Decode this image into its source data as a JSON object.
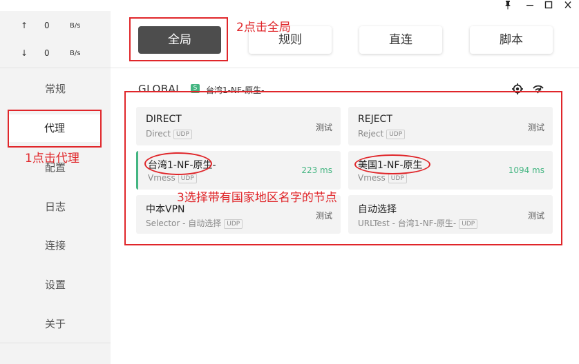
{
  "titlebar": {
    "pin_icon": "pin-icon",
    "min_icon": "minimize-icon",
    "max_icon": "maximize-icon",
    "close_icon": "close-icon"
  },
  "speed": {
    "up": {
      "arrow": "↑",
      "value": "0",
      "unit": "B/s"
    },
    "down": {
      "arrow": "↓",
      "value": "0",
      "unit": "B/s"
    }
  },
  "sidebar": {
    "items": [
      {
        "label": "常规"
      },
      {
        "label": "代理"
      },
      {
        "label": "配置"
      },
      {
        "label": "日志"
      },
      {
        "label": "连接"
      },
      {
        "label": "设置"
      },
      {
        "label": "关于"
      }
    ]
  },
  "modes": [
    {
      "label": "全局"
    },
    {
      "label": "规则"
    },
    {
      "label": "直连"
    },
    {
      "label": "脚本"
    }
  ],
  "group": {
    "name": "GLOBAL",
    "badge": "S",
    "selected": "台湾1-NF-原生-"
  },
  "proxies": [
    {
      "name": "DIRECT",
      "type": "Direct",
      "udp": "UDP",
      "right": "测试"
    },
    {
      "name": "REJECT",
      "type": "Reject",
      "udp": "UDP",
      "right": "测试"
    },
    {
      "name": "台湾1-NF-原生-",
      "type": "Vmess",
      "udp": "UDP",
      "right": "223 ms"
    },
    {
      "name": "美国1-NF-原生",
      "type": "Vmess",
      "udp": "UDP",
      "right": "1094 ms"
    },
    {
      "name": "中本VPN",
      "type": "Selector - 自动选择",
      "udp": "UDP",
      "right": "测试"
    },
    {
      "name": "自动选择",
      "type": "URLTest - 台湾1-NF-原生-",
      "udp": "UDP",
      "right": "测试"
    }
  ],
  "annotations": {
    "step1": "1点击代理",
    "step2": "2点击全局",
    "step3": "3选择带有国家地区名字的节点"
  },
  "colors": {
    "accent": "#43b581",
    "annotation": "#e0262a",
    "active_mode": "#4d4d4d"
  }
}
